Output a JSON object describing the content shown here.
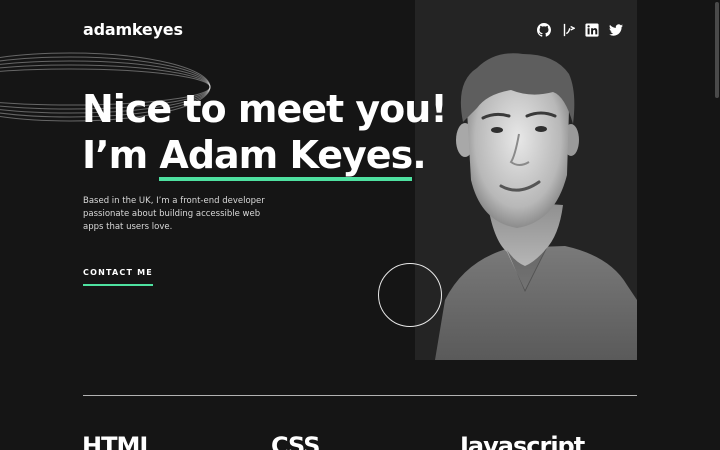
{
  "header": {
    "logo": "adamkeyes",
    "social": [
      "github-icon",
      "frontend-mentor-icon",
      "linkedin-icon",
      "twitter-icon"
    ]
  },
  "hero": {
    "headline_line1": "Nice to meet you!",
    "headline_line2_prefix": "I’m ",
    "headline_name": "Adam Keyes",
    "headline_suffix": ".",
    "intro": "Based in the UK, I’m a front-end developer passionate about building accessible web apps that users love.",
    "cta": "CONTACT ME"
  },
  "skills": [
    {
      "name": "HTML"
    },
    {
      "name": "CSS"
    },
    {
      "name": "Javascript"
    }
  ],
  "colors": {
    "background": "#151515",
    "panel": "#242424",
    "accent": "#4ee1a0",
    "text": "#ffffff",
    "muted": "#d9d9d9"
  }
}
